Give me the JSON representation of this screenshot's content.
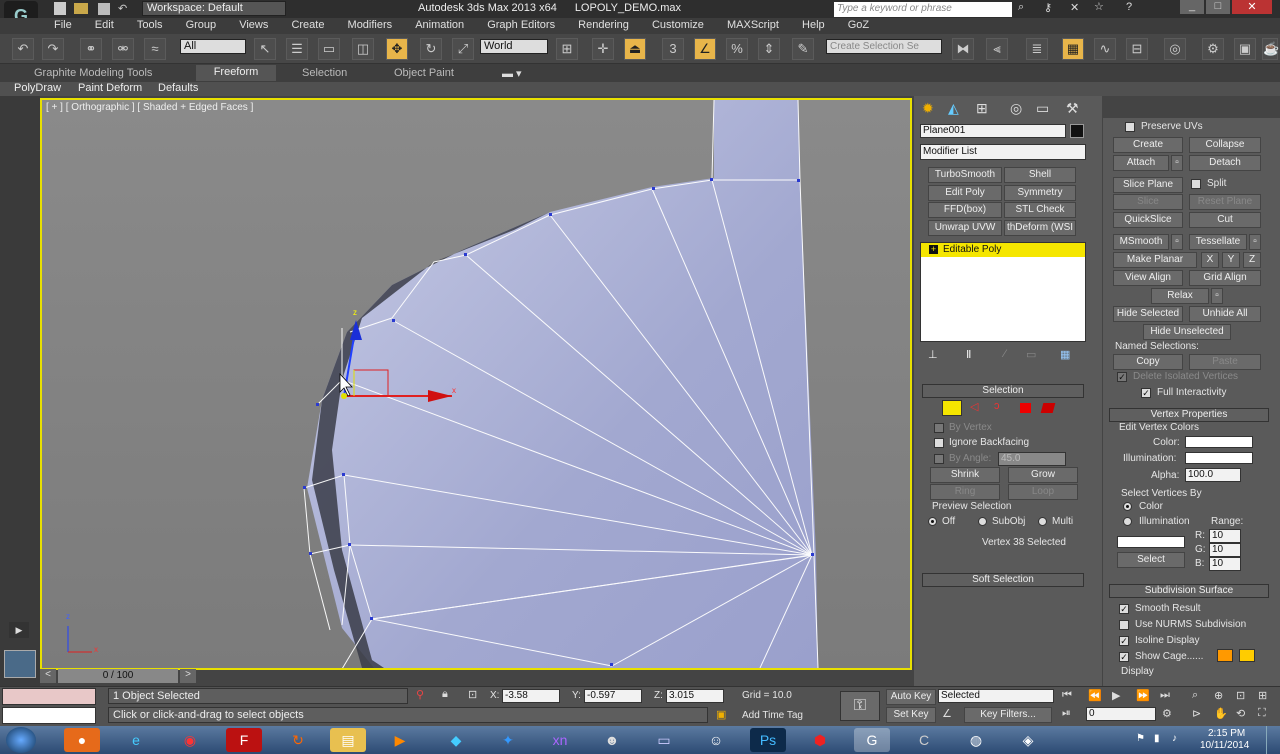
{
  "titlebar": {
    "workspace": "Workspace: Default",
    "app_title": "Autodesk 3ds Max  2013 x64",
    "file": "LOPOLY_DEMO.max",
    "search_placeholder": "Type a keyword or phrase"
  },
  "menu": [
    "File",
    "Edit",
    "Tools",
    "Group",
    "Views",
    "Create",
    "Modifiers",
    "Animation",
    "Graph Editors",
    "Rendering",
    "Customize",
    "MAXScript",
    "Help",
    "GoZ"
  ],
  "toolbar": {
    "filter": "All",
    "coord": "World",
    "selection_set_placeholder": "Create Selection Se",
    "snap_3": "3",
    "pct": "%"
  },
  "ribbon": {
    "tabs": [
      "Graphite Modeling Tools",
      "Freeform",
      "Selection",
      "Object Paint"
    ],
    "active": "Freeform",
    "sub": [
      "PolyDraw",
      "Paint Deform",
      "Defaults"
    ]
  },
  "viewport": {
    "label": "[ + ] [ Orthographic ] [ Shaded + Edged Faces ]",
    "gizmo_z": "z",
    "gizmo_x": "x",
    "axis_z": "z",
    "axis_x": "x"
  },
  "cmd": {
    "object_name": "Plane001",
    "modifier_list": "Modifier List",
    "mod_buttons": [
      "TurboSmooth",
      "Shell",
      "Edit Poly",
      "Symmetry",
      "FFD(box)",
      "STL Check",
      "Unwrap UVW",
      "thDeform (WSI"
    ],
    "stack_item": "Editable Poly"
  },
  "selection": {
    "title": "Selection",
    "by_vertex": "By Vertex",
    "ignore_backfacing": "Ignore Backfacing",
    "by_angle": "By Angle:",
    "angle_value": "45.0",
    "shrink": "Shrink",
    "grow": "Grow",
    "ring": "Ring",
    "loop": "Loop",
    "preview_title": "Preview Selection",
    "off": "Off",
    "subobj": "SubObj",
    "multi": "Multi",
    "status": "Vertex 38 Selected"
  },
  "soft_selection": "Soft Selection",
  "edit_geom": {
    "preserve_uvs": "Preserve UVs",
    "create": "Create",
    "collapse": "Collapse",
    "attach": "Attach",
    "detach": "Detach",
    "slice_plane": "Slice Plane",
    "split": "Split",
    "slice": "Slice",
    "reset_plane": "Reset Plane",
    "quickslice": "QuickSlice",
    "cut": "Cut",
    "msmooth": "MSmooth",
    "tessellate": "Tessellate",
    "make_planar": "Make Planar",
    "x": "X",
    "y": "Y",
    "z": "Z",
    "view_align": "View Align",
    "grid_align": "Grid Align",
    "relax": "Relax",
    "hide_selected": "Hide Selected",
    "unhide_all": "Unhide All",
    "hide_unselected": "Hide Unselected",
    "named_sel": "Named Selections:",
    "copy": "Copy",
    "paste": "Paste",
    "delete_isolated": "Delete Isolated Vertices",
    "full_interactivity": "Full Interactivity"
  },
  "vertex_props": {
    "title": "Vertex Properties",
    "edit_colors": "Edit Vertex Colors",
    "color": "Color:",
    "illumination": "Illumination:",
    "alpha": "Alpha:",
    "alpha_value": "100.0",
    "select_by": "Select Vertices By",
    "opt_color": "Color",
    "opt_illum": "Illumination",
    "range": "Range:",
    "r": "R:",
    "g": "G:",
    "b": "B:",
    "r_val": "10",
    "g_val": "10",
    "b_val": "10",
    "select": "Select"
  },
  "subdiv": {
    "title": "Subdivision Surface",
    "smooth_result": "Smooth Result",
    "use_nurms": "Use NURMS Subdivision",
    "isoline": "Isoline Display",
    "show_cage": "Show Cage......",
    "display": "Display"
  },
  "timeline": {
    "frame": "0 / 100"
  },
  "status": {
    "objects": "1 Object Selected",
    "prompt": "Click or click-and-drag to select objects",
    "x_label": "X:",
    "x": "-3.58",
    "y_label": "Y:",
    "y": "-0.597",
    "z_label": "Z:",
    "z": "3.015",
    "grid": "Grid = 10.0",
    "add_time_tag": "Add Time Tag",
    "auto_key": "Auto Key",
    "set_key": "Set Key",
    "selected": "Selected",
    "key_filters": "Key Filters...",
    "frame_field": "0"
  },
  "taskbar": {
    "time": "2:15 PM",
    "date": "10/11/2014"
  },
  "colors": {
    "viewport_border": "#e8e000",
    "stack_highlight": "#f5e600",
    "cage1": "#ff9900",
    "cage2": "#ffcc00",
    "vertex_icon": "#f5e600"
  }
}
